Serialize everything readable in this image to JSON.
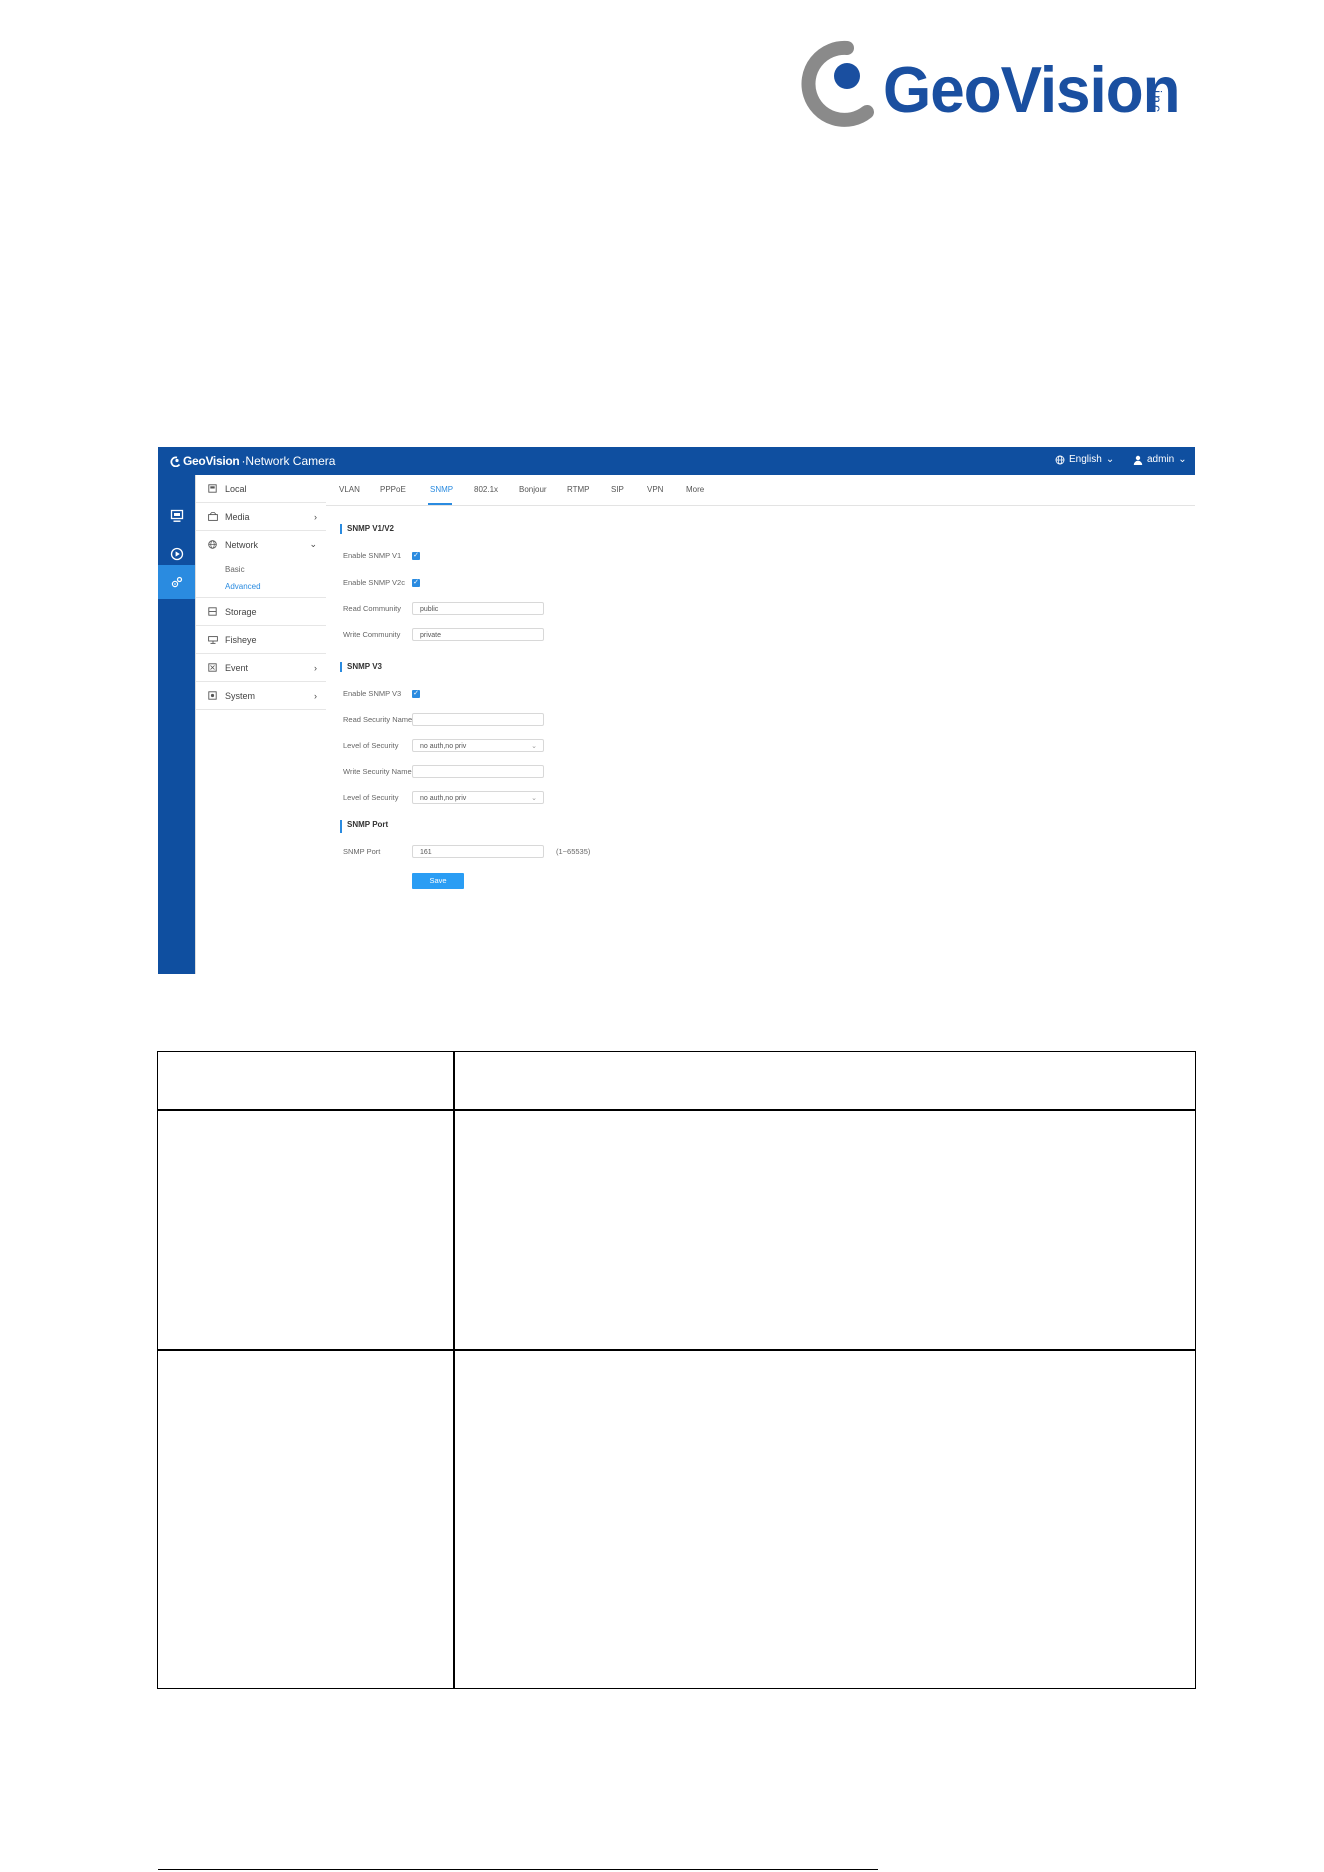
{
  "logo": {
    "word": "GeoVision",
    "suffix": "inc"
  },
  "app": {
    "brand": "GeoVision",
    "title": "·Network Camera",
    "language": "English",
    "user": "admin"
  },
  "sidebar": {
    "items": [
      {
        "label": "Local",
        "icon": "local-icon"
      },
      {
        "label": "Media",
        "icon": "media-icon",
        "chevron": "›"
      },
      {
        "label": "Network",
        "icon": "globe-icon",
        "chevron": "⌄"
      },
      {
        "label": "Storage",
        "icon": "storage-icon"
      },
      {
        "label": "Fisheye",
        "icon": "fisheye-icon"
      },
      {
        "label": "Event",
        "icon": "event-icon",
        "chevron": "›"
      },
      {
        "label": "System",
        "icon": "system-icon",
        "chevron": "›"
      }
    ],
    "network_sub": [
      "Basic",
      "Advanced"
    ]
  },
  "tabs": [
    "VLAN",
    "PPPoE",
    "SNMP",
    "802.1x",
    "Bonjour",
    "RTMP",
    "SIP",
    "VPN",
    "More"
  ],
  "form": {
    "section_v1v2": "SNMP V1/V2",
    "enable_v1": "Enable SNMP V1",
    "enable_v2c": "Enable SNMP V2c",
    "read_community_label": "Read Community",
    "read_community_value": "public",
    "write_community_label": "Write Community",
    "write_community_value": "private",
    "section_v3": "SNMP V3",
    "enable_v3": "Enable SNMP V3",
    "read_security_label": "Read Security Name",
    "level_security_label_1": "Level of Security",
    "level_security_value_1": "no auth,no priv",
    "write_security_label": "Write Security Name",
    "level_security_label_2": "Level of Security",
    "level_security_value_2": "no auth,no priv",
    "section_port": "SNMP Port",
    "port_label": "SNMP Port",
    "port_value": "161",
    "port_hint": "(1~65535)",
    "save": "Save"
  },
  "colors": {
    "brand_blue": "#0f4fa0",
    "accent": "#2a8be0",
    "button": "#2a9df4"
  }
}
